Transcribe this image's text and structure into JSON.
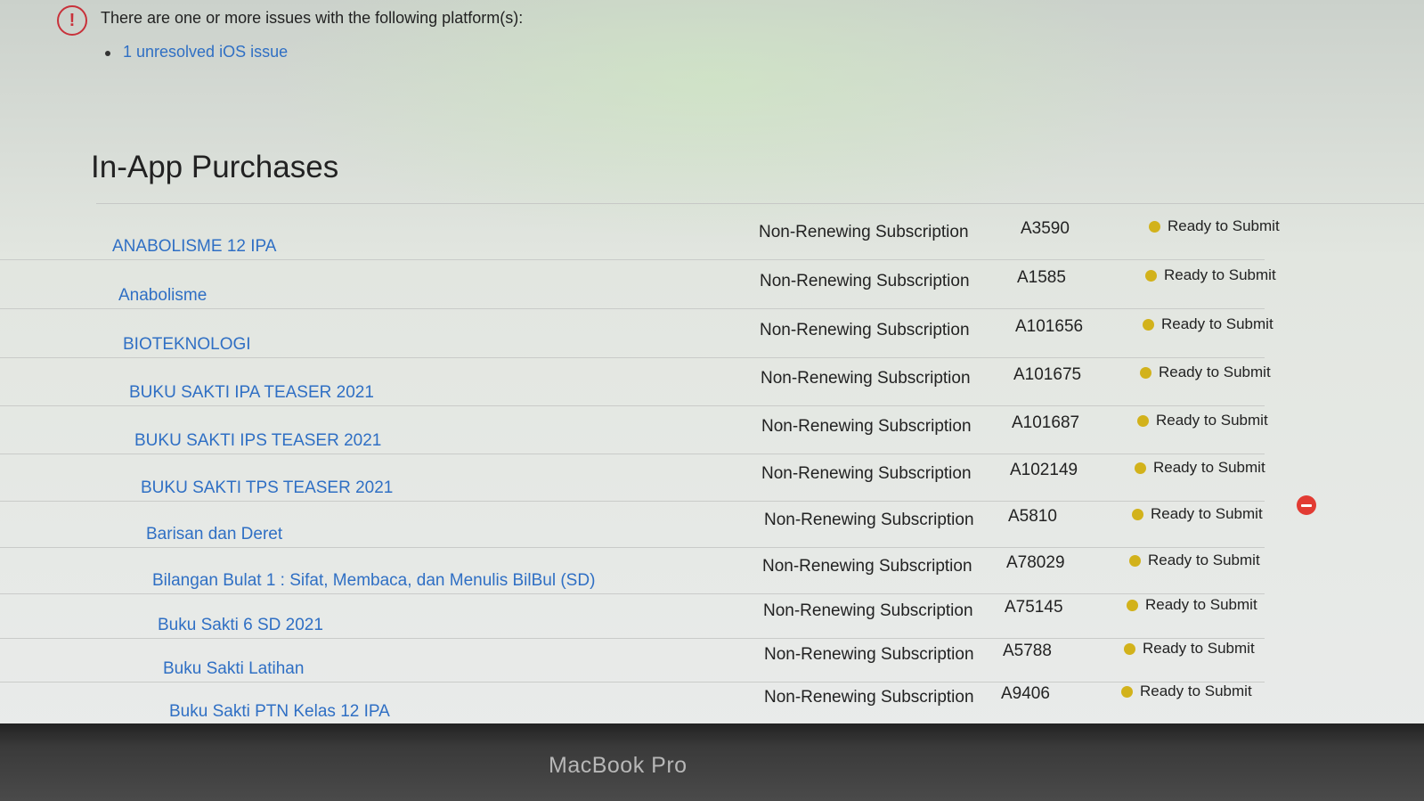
{
  "notice": {
    "icon": "exclamation-circle-icon",
    "icon_glyph": "!",
    "message": "There are one or more issues with the following platform(s):",
    "issues": [
      "1 unresolved iOS issue"
    ],
    "accent_color": "#c8313a"
  },
  "section": {
    "title": "In-App Purchases"
  },
  "status_color": "#d2b21b",
  "iap_items": [
    {
      "name": "ANABOLISME 12 IPA",
      "type": "Non-Renewing Subscription",
      "id": "A3590",
      "status": "Ready to Submit"
    },
    {
      "name": "Anabolisme",
      "type": "Non-Renewing Subscription",
      "id": "A1585",
      "status": "Ready to Submit"
    },
    {
      "name": "BIOTEKNOLOGI",
      "type": "Non-Renewing Subscription",
      "id": "A101656",
      "status": "Ready to Submit"
    },
    {
      "name": "BUKU SAKTI IPA TEASER 2021",
      "type": "Non-Renewing Subscription",
      "id": "A101675",
      "status": "Ready to Submit"
    },
    {
      "name": "BUKU SAKTI IPS TEASER 2021",
      "type": "Non-Renewing Subscription",
      "id": "A101687",
      "status": "Ready to Submit"
    },
    {
      "name": "BUKU SAKTI TPS TEASER 2021",
      "type": "Non-Renewing Subscription",
      "id": "A102149",
      "status": "Ready to Submit"
    },
    {
      "name": "Barisan dan Deret",
      "type": "Non-Renewing Subscription",
      "id": "A5810",
      "status": "Ready to Submit"
    },
    {
      "name": "Bilangan Bulat 1 : Sifat, Membaca, dan Menulis BilBul (SD)",
      "type": "Non-Renewing Subscription",
      "id": "A78029",
      "status": "Ready to Submit"
    },
    {
      "name": "Buku Sakti 6 SD 2021",
      "type": "Non-Renewing Subscription",
      "id": "A75145",
      "status": "Ready to Submit"
    },
    {
      "name": "Buku Sakti Latihan",
      "type": "Non-Renewing Subscription",
      "id": "A5788",
      "status": "Ready to Submit"
    },
    {
      "name": "Buku Sakti PTN Kelas 12 IPA",
      "type": "Non-Renewing Subscription",
      "id": "A9406",
      "status": "Ready to Submit"
    }
  ],
  "remove_icon": "remove-circle-icon",
  "device_label": "MacBook Pro"
}
